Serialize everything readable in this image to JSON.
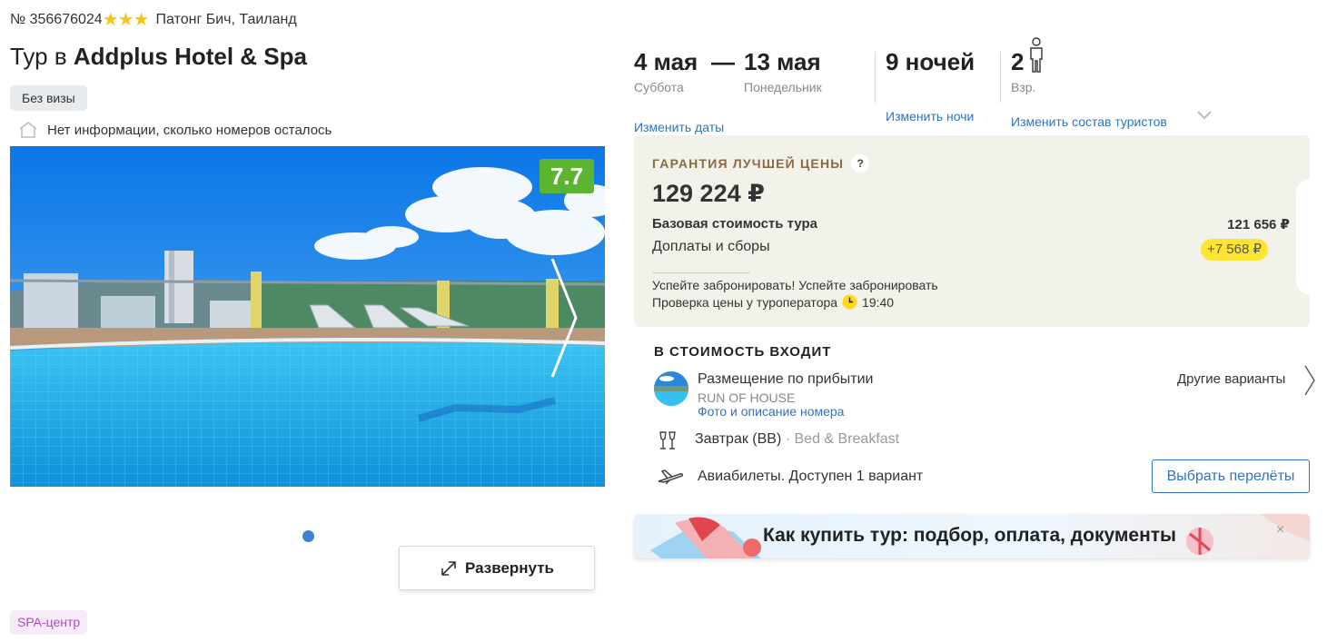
{
  "header": {
    "tour_number": "№ 356676024",
    "stars": 3,
    "location": "Патонг Бич, Таиланд",
    "title_prefix": "Тур в ",
    "title_hotel": "Addplus Hotel & Spa",
    "visa_badge": "Без визы",
    "rooms_info": "Нет информации, сколько номеров осталось"
  },
  "gallery": {
    "rating": "7.7",
    "expand_label": "Развернуть",
    "active_dot_color": "#3b82d6"
  },
  "tags": {
    "spa": "SPA-центр"
  },
  "dates": {
    "start_date": "4 мая",
    "dash": "—",
    "end_date": "13 мая",
    "start_day": "Суббота",
    "end_day": "Понедельник",
    "change_dates": "Изменить даты",
    "nights": "9 ночей",
    "change_nights": "Изменить ночи",
    "tourists_count": "2",
    "tourists_label": "Взр.",
    "change_tourists": "Изменить состав туристов"
  },
  "price": {
    "guarantee_label": "ГАРАНТИЯ ЛУЧШЕЙ ЦЕНЫ",
    "help_icon": "?",
    "total": "129 224 ₽",
    "base_label": "Базовая стоимость тура",
    "base_value": "121 656 ₽",
    "extra_label": "Доплаты и сборы",
    "extra_value": "+7 568 ₽",
    "hurry_text": "Успейте забронировать! Успейте забронировать",
    "check_text": "Проверка цены у туроператора",
    "check_time": "19:40"
  },
  "included": {
    "title": "В СТОИМОСТЬ ВХОДИТ",
    "room_name": "Размещение по прибытии",
    "room_type": "RUN OF HOUSE",
    "room_link": "Фото и описание номера",
    "other_variants": "Другие варианты",
    "meal": "Завтрак (BB)",
    "meal_sep": " · ",
    "meal_desc": "Bed & Breakfast",
    "flights": "Авиабилеты. Доступен 1 вариант",
    "flights_button": "Выбрать перелёты"
  },
  "banner": {
    "text": "Как купить тур: подбор, оплата, документы",
    "close": "×"
  },
  "icons": {
    "star": "star-icon",
    "house": "house-icon",
    "chevron_right": "chevron-right-icon",
    "expand": "expand-icon",
    "person": "person-icon",
    "chevron_down": "chevron-down-icon",
    "clock": "clock-icon",
    "meal": "wine-glasses-icon",
    "plane": "plane-icon"
  }
}
